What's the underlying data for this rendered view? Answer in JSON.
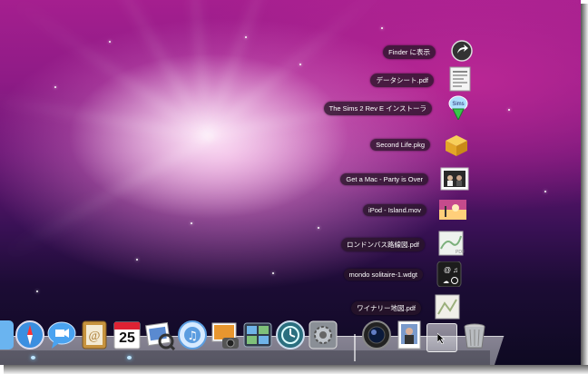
{
  "desktop": {
    "wallpaper": "Leopard aurora"
  },
  "stack": {
    "items": [
      {
        "label": "Finder に表示",
        "icon": "finder-arrow-icon"
      },
      {
        "label": "データシート.pdf",
        "icon": "pdf-document-icon"
      },
      {
        "label": "The Sims 2 Rev E インストーラ",
        "icon": "sims-installer-icon"
      },
      {
        "label": "Second Life.pkg",
        "icon": "package-icon"
      },
      {
        "label": "Get a Mac - Party is Over",
        "icon": "video-thumbnail-icon"
      },
      {
        "label": "iPod - Island.mov",
        "icon": "movie-thumbnail-icon"
      },
      {
        "label": "ロンドンバス路線図.pdf",
        "icon": "pdf-map-icon"
      },
      {
        "label": "mondo solitaire-1.wdgt",
        "icon": "widget-icon"
      },
      {
        "label": "ワイナリー地図.pdf",
        "icon": "pdf-map-icon"
      }
    ]
  },
  "dock": {
    "apps": [
      {
        "name": "Safari",
        "icon": "safari-icon"
      },
      {
        "name": "iChat",
        "icon": "ichat-icon"
      },
      {
        "name": "Address Book",
        "icon": "address-book-icon"
      },
      {
        "name": "iCal",
        "icon": "ical-icon"
      },
      {
        "name": "Preview",
        "icon": "preview-icon"
      },
      {
        "name": "iTunes",
        "icon": "itunes-icon"
      },
      {
        "name": "iPhoto",
        "icon": "iphoto-icon"
      },
      {
        "name": "Spaces",
        "icon": "spaces-icon"
      },
      {
        "name": "Time Machine",
        "icon": "time-machine-icon"
      },
      {
        "name": "System Preferences",
        "icon": "system-preferences-icon"
      }
    ],
    "ical_day": "25",
    "documents": [
      {
        "name": "Photo Booth",
        "icon": "camera-lens-icon"
      },
      {
        "name": "Pictures",
        "icon": "picture-frame-icon"
      },
      {
        "name": "Downloads",
        "icon": "downloads-stack-icon"
      },
      {
        "name": "Trash",
        "icon": "trash-icon"
      }
    ]
  }
}
